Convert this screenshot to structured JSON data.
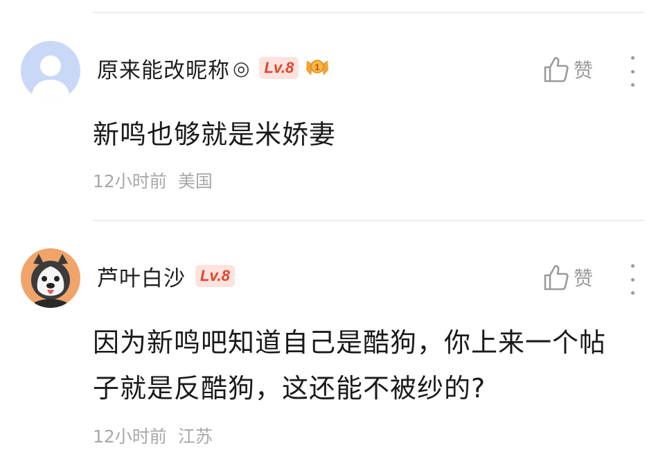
{
  "comments": [
    {
      "username": "原来能改昵称",
      "verified_mark": "◎",
      "level": "Lv.8",
      "medal_badge": "1",
      "like_label": "赞",
      "content": "新鸣也够就是米娇妻",
      "time": "12小时前",
      "location": "美国"
    },
    {
      "username": "芦叶白沙",
      "level": "Lv.8",
      "like_label": "赞",
      "content": "因为新鸣吧知道自己是酷狗，你上来一个帖子就是反酷狗，这还能不被纱的?",
      "time": "12小时前",
      "location": "江苏"
    }
  ],
  "colors": {
    "level_bg": "#fde3de",
    "level_text": "#e0452b",
    "meta_text": "#a8a8a8",
    "icon_gray": "#9a9a9a"
  }
}
